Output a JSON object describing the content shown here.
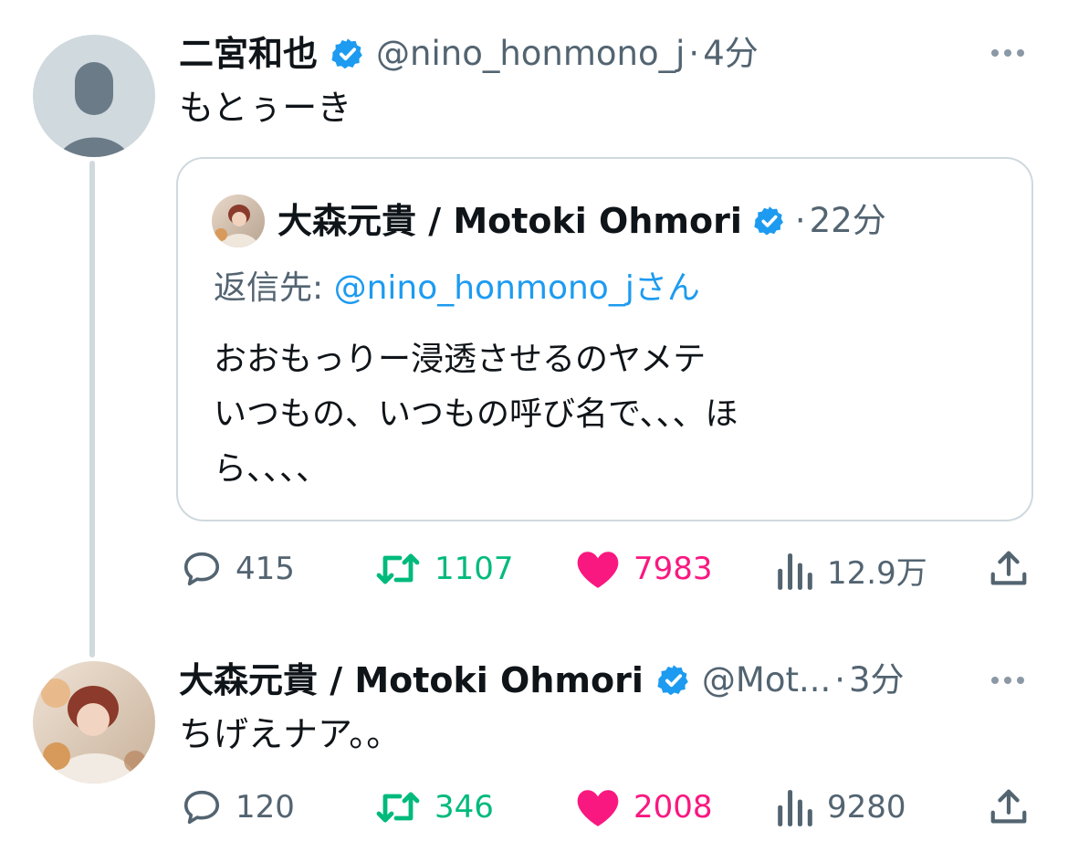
{
  "colors": {
    "verified": "#1d9bf0",
    "retweet": "#00ba7c",
    "like": "#f91880",
    "meta": "#536471",
    "link": "#1d9bf0"
  },
  "tweet1": {
    "name": "二宮和也",
    "handle": "@nino_honmono_j",
    "separator": "·",
    "time": "4分",
    "text": "もとぅーき",
    "quote": {
      "name": "大森元貴 / Motoki Ohmori",
      "separator": "·",
      "time": "22分",
      "reply_prefix": "返信先: ",
      "reply_handle": "@nino_honmono_j",
      "reply_suffix": "さん",
      "lines": [
        "おおもっりー浸透させるのヤメテ",
        "いつもの、いつもの呼び名で、、、ほ",
        "ら、、、、"
      ]
    },
    "actions": {
      "replies": "415",
      "retweets": "1107",
      "likes": "7983",
      "views": "12.9万"
    }
  },
  "tweet2": {
    "name": "大森元貴 / Motoki Ohmori",
    "handle": "@Mot...",
    "separator": "·",
    "time": "3分",
    "text": "ちげえナア。。",
    "actions": {
      "replies": "120",
      "retweets": "346",
      "likes": "2008",
      "views": "9280"
    }
  },
  "icons": [
    "verified-badge-icon",
    "more-icon",
    "reply-icon",
    "retweet-icon",
    "like-icon",
    "views-icon",
    "share-icon",
    "default-avatar-icon"
  ]
}
